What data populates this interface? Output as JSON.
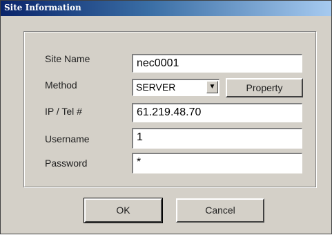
{
  "window": {
    "title": "Site Information"
  },
  "form": {
    "site_name": {
      "label": "Site Name",
      "value": "nec0001"
    },
    "method": {
      "label": "Method",
      "value": "SERVER",
      "arrow": "▼"
    },
    "property_button": "Property",
    "ip": {
      "label": "IP / Tel #",
      "value": "61.219.48.70"
    },
    "username": {
      "label": "Username",
      "value": "1"
    },
    "password": {
      "label": "Password",
      "value": "*"
    }
  },
  "buttons": {
    "ok": "OK",
    "cancel": "Cancel"
  },
  "icons": {
    "method_dropdown": "chevron-down-icon"
  }
}
